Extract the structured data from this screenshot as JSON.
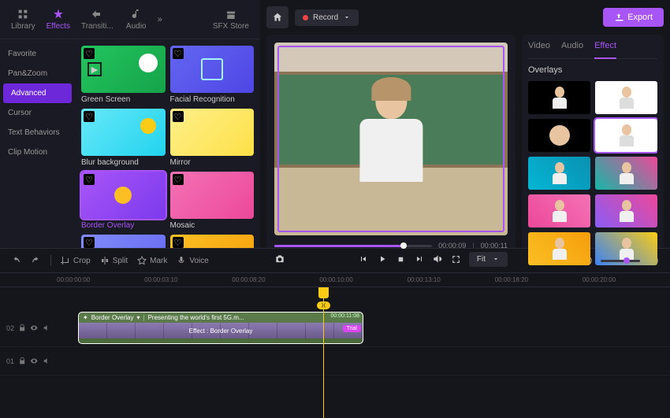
{
  "tabs": {
    "library": "Library",
    "effects": "Effects",
    "transitions": "Transiti...",
    "audio": "Audio",
    "sfx": "SFX Store"
  },
  "sidebar": {
    "items": [
      "Favorite",
      "Pan&Zoom",
      "Advanced",
      "Cursor",
      "Text Behaviors",
      "Clip Motion"
    ]
  },
  "effects": {
    "items": [
      {
        "label": "Green Screen"
      },
      {
        "label": "Facial Recognition"
      },
      {
        "label": "Blur background"
      },
      {
        "label": "Mirror"
      },
      {
        "label": "Border Overlay",
        "selected": true
      },
      {
        "label": "Mosaic"
      }
    ]
  },
  "topbar": {
    "record": "Record",
    "export": "Export"
  },
  "player": {
    "current": "00:00:09",
    "duration": "00:00:11",
    "fit": "Fit"
  },
  "rightPanel": {
    "tabs": {
      "video": "Video",
      "audio": "Audio",
      "effect": "Effect"
    },
    "title": "Overlays"
  },
  "toolbar": {
    "crop": "Crop",
    "split": "Split",
    "mark": "Mark",
    "voice": "Voice"
  },
  "ruler": [
    "00:00:00:00",
    "00:00:03:10",
    "00:00:08:20",
    "00:00:10:00",
    "00:00:13:10",
    "00:00:18:20",
    "00:00:20:00"
  ],
  "tracks": {
    "t1": "02",
    "t2": "01"
  },
  "clip": {
    "name": "Border Overlay",
    "title": "Presenting the world's first 5G.m...",
    "effect": "Effect : Border Overlay",
    "trial": "Trial",
    "time": "00:00:11:08"
  }
}
